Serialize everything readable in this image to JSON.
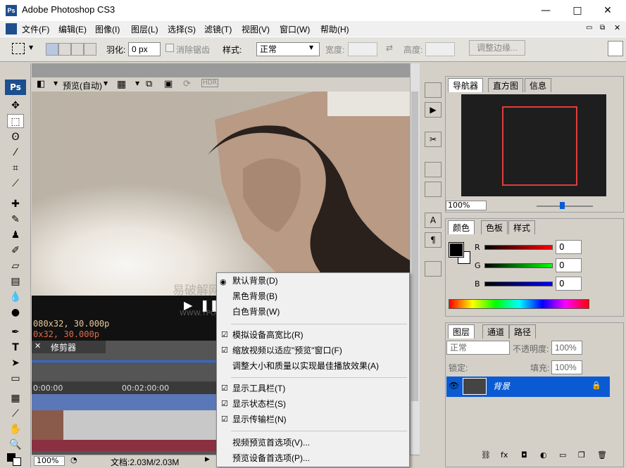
{
  "window": {
    "title": "Adobe Photoshop CS3",
    "logo": "Ps",
    "minimize": "—",
    "maximize": "□",
    "close": "✕"
  },
  "menu": [
    "文件(F)",
    "编辑(E)",
    "图像(I)",
    "图层(L)",
    "选择(S)",
    "滤镜(T)",
    "视图(V)",
    "窗口(W)",
    "帮助(H)"
  ],
  "options": {
    "feather_label": "羽化:",
    "feather_value": "0 px",
    "antialias_label": "消除锯齿",
    "style_label": "样式:",
    "style_value": "正常",
    "width_label": "宽度:",
    "height_label": "高度:",
    "refine_label": "调整边缘..."
  },
  "preview_bar": {
    "mode_label": "预览(自动)"
  },
  "video": {
    "res1": "080x32, 30.000p",
    "res2": "0x32, 30.000p",
    "watermark": "易破解网站",
    "watermark_url": "WWW.YPOJIE.COM"
  },
  "timeline": {
    "tab_close": "✕",
    "tab_label": "修剪器",
    "t0": "0:00:00",
    "t1": "00:02:00:00"
  },
  "status": {
    "zoom": "100%",
    "doc": "文档:2.03M/2.03M"
  },
  "context_menu": {
    "items": [
      {
        "label": "默认背景(D)",
        "mark": "radio"
      },
      {
        "label": "黑色背景(B)",
        "mark": ""
      },
      {
        "label": "白色背景(W)",
        "mark": ""
      },
      {
        "label": "模拟设备高宽比(R)",
        "mark": "check"
      },
      {
        "label": "缩放视频以适应\"预览\"窗口(F)",
        "mark": "check"
      },
      {
        "label": "调整大小和质量以实现最佳播放效果(A)",
        "mark": ""
      },
      {
        "label": "显示工具栏(T)",
        "mark": "check"
      },
      {
        "label": "显示状态栏(S)",
        "mark": "check"
      },
      {
        "label": "显示传输栏(N)",
        "mark": "check"
      },
      {
        "label": "视频预览首选项(V)...",
        "mark": ""
      },
      {
        "label": "预览设备首选项(P)...",
        "mark": ""
      }
    ]
  },
  "navigator": {
    "tabs": [
      "导航器",
      "直方图",
      "信息"
    ],
    "zoom": "100%"
  },
  "color": {
    "tabs": [
      "颜色",
      "色板",
      "样式"
    ],
    "r_label": "R",
    "g_label": "G",
    "b_label": "B",
    "r": "0",
    "g": "0",
    "b": "0"
  },
  "layers": {
    "tabs": [
      "图层",
      "通道",
      "路径"
    ],
    "blend": "正常",
    "opacity_label": "不透明度:",
    "opacity": "100%",
    "lock_label": "锁定:",
    "fill_label": "填充:",
    "fill": "100%",
    "layer_name": "背景"
  },
  "colors": {
    "accent": "#0a5bd3",
    "panel": "#d4d0c8",
    "menu_bg": "#f0f0f0"
  }
}
